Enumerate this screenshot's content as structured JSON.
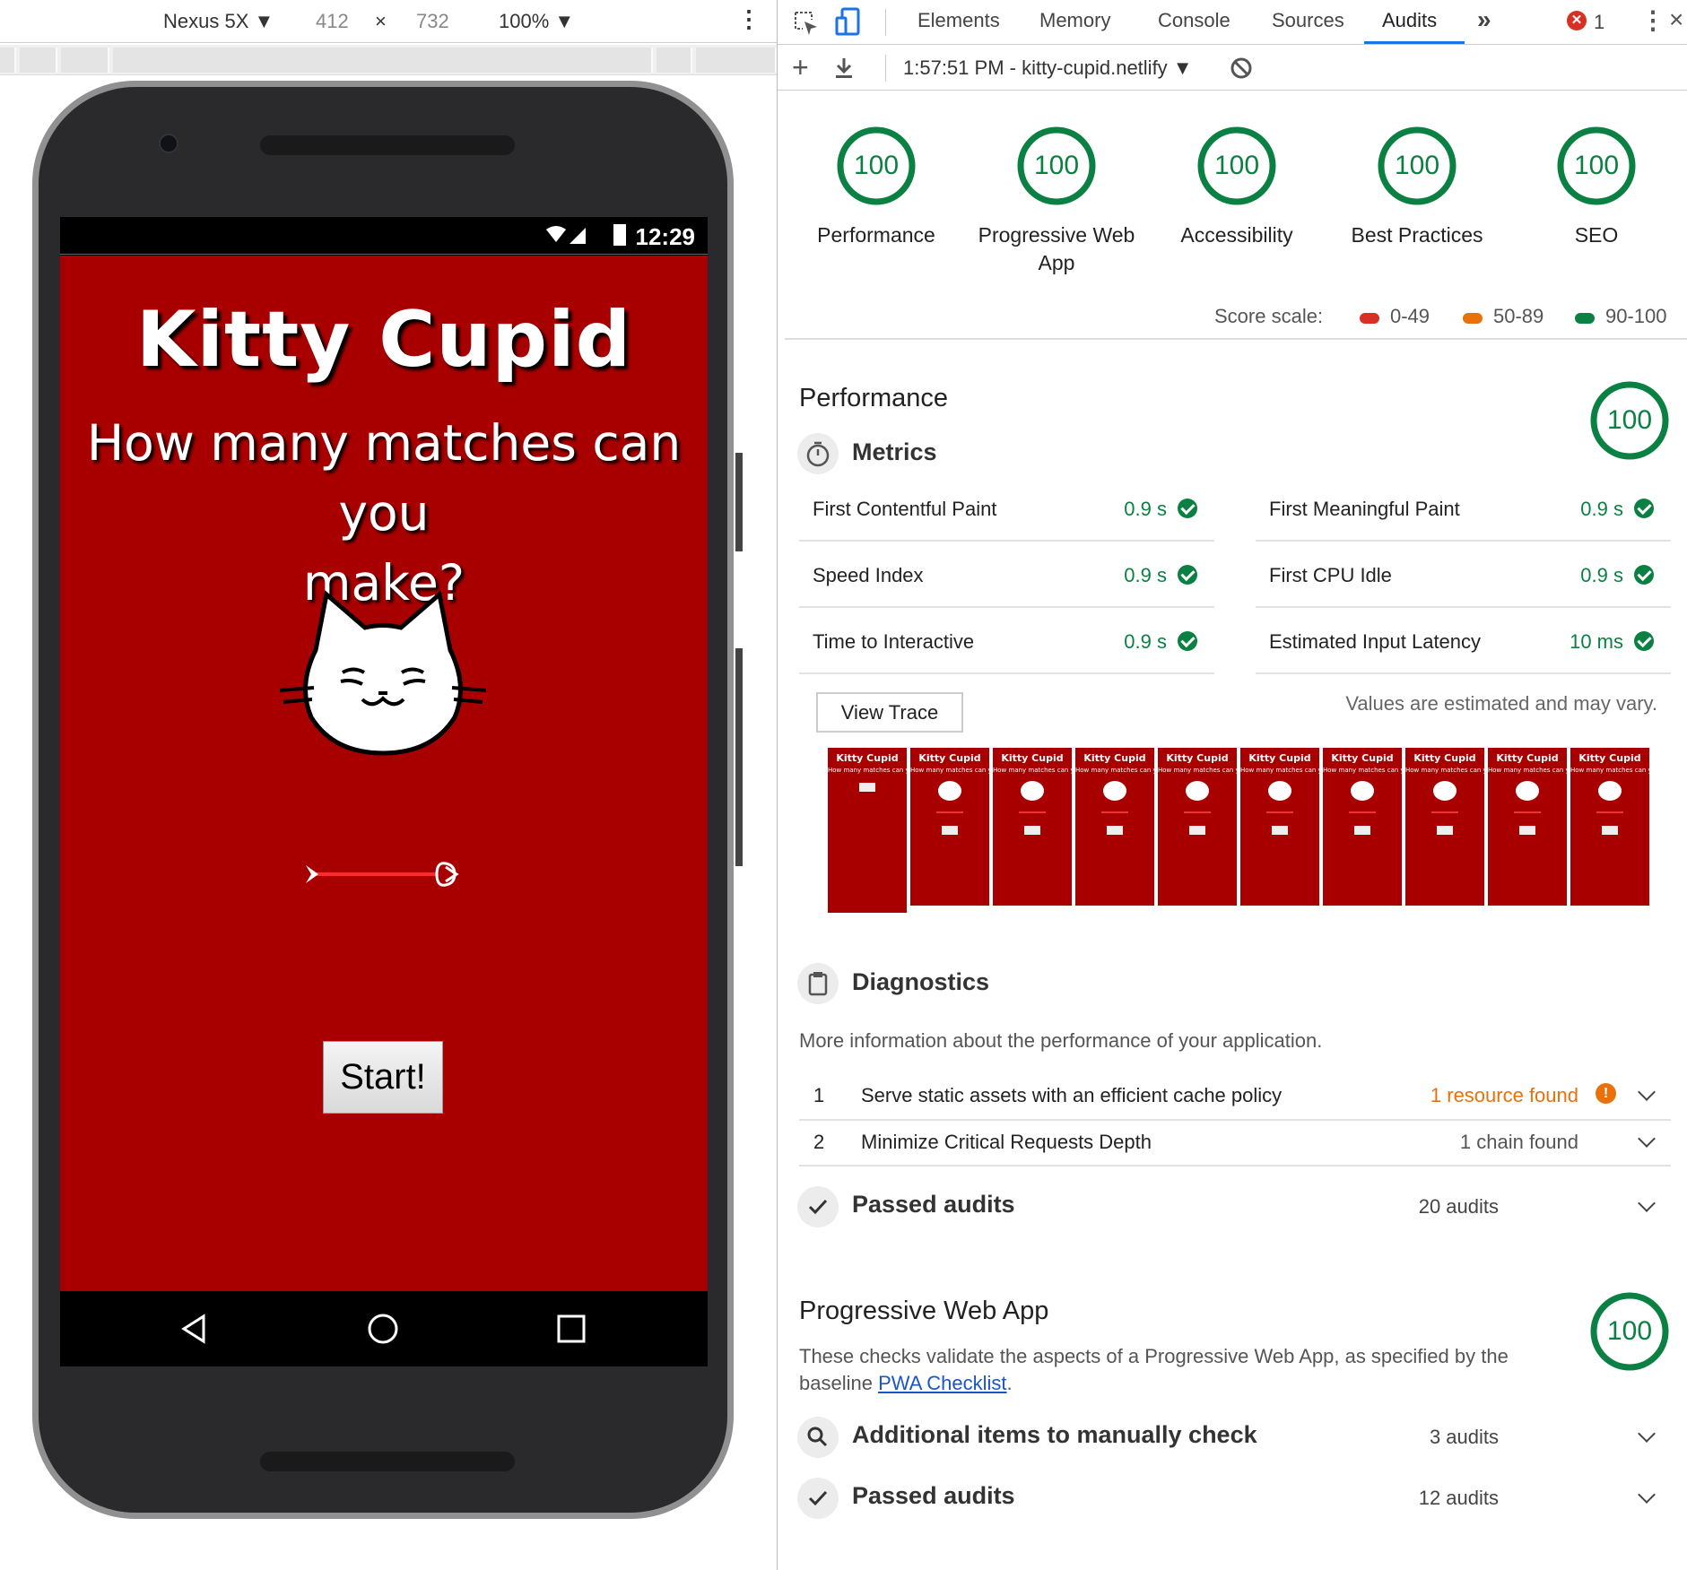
{
  "device_toolbar": {
    "device": "Nexus 5X",
    "width": "412",
    "times": "×",
    "height": "732",
    "zoom": "100%"
  },
  "phone": {
    "time": "12:29",
    "app_title": "Kitty Cupid",
    "app_subtitle_line1": "How many matches can you",
    "app_subtitle_line2": "make?",
    "start_label": "Start!"
  },
  "devtools": {
    "tabs": [
      "Elements",
      "Memory",
      "Console",
      "Sources",
      "Audits"
    ],
    "active_tab": "Audits",
    "more_tabs": "»",
    "error_count": "1",
    "report_label": "1:57:51 PM - kitty-cupid.netlify"
  },
  "categories": [
    {
      "label": "Performance",
      "score": "100"
    },
    {
      "label": "Progressive Web App",
      "score": "100"
    },
    {
      "label": "Accessibility",
      "score": "100"
    },
    {
      "label": "Best Practices",
      "score": "100"
    },
    {
      "label": "SEO",
      "score": "100"
    }
  ],
  "score_scale": {
    "label": "Score scale:",
    "ranges": [
      {
        "range": "0-49",
        "color": "#d93025"
      },
      {
        "range": "50-89",
        "color": "#e8710a"
      },
      {
        "range": "90-100",
        "color": "#0b8043"
      }
    ]
  },
  "performance": {
    "title": "Performance",
    "score": "100",
    "metrics_title": "Metrics",
    "metrics": [
      {
        "name": "First Contentful Paint",
        "value": "0.9 s"
      },
      {
        "name": "First Meaningful Paint",
        "value": "0.9 s"
      },
      {
        "name": "Speed Index",
        "value": "0.9 s"
      },
      {
        "name": "First CPU Idle",
        "value": "0.9 s"
      },
      {
        "name": "Time to Interactive",
        "value": "0.9 s"
      },
      {
        "name": "Estimated Input Latency",
        "value": "10 ms"
      }
    ],
    "view_trace_label": "View Trace",
    "estimate_note": "Values are estimated and may vary.",
    "filmstrip_frame_title": "Kitty Cupid",
    "filmstrip_frame_subtitle": "How many matches can you make?",
    "diagnostics_title": "Diagnostics",
    "diagnostics_desc": "More information about the performance of your application.",
    "diagnostics": [
      {
        "num": "1",
        "name": "Serve static assets with an efficient cache policy",
        "result": "1 resource found",
        "color": "#e8710a"
      },
      {
        "num": "2",
        "name": "Minimize Critical Requests Depth",
        "result": "1 chain found",
        "color": "#555555"
      }
    ],
    "passed_title": "Passed audits",
    "passed_count": "20 audits"
  },
  "pwa": {
    "title": "Progressive Web App",
    "score": "100",
    "desc_prefix": "These checks validate the aspects of a Progressive Web App, as specified by the baseline ",
    "desc_link": "PWA Checklist",
    "desc_suffix": ".",
    "manual_title": "Additional items to manually check",
    "manual_count": "3 audits",
    "passed_title": "Passed audits",
    "passed_count": "12 audits"
  }
}
